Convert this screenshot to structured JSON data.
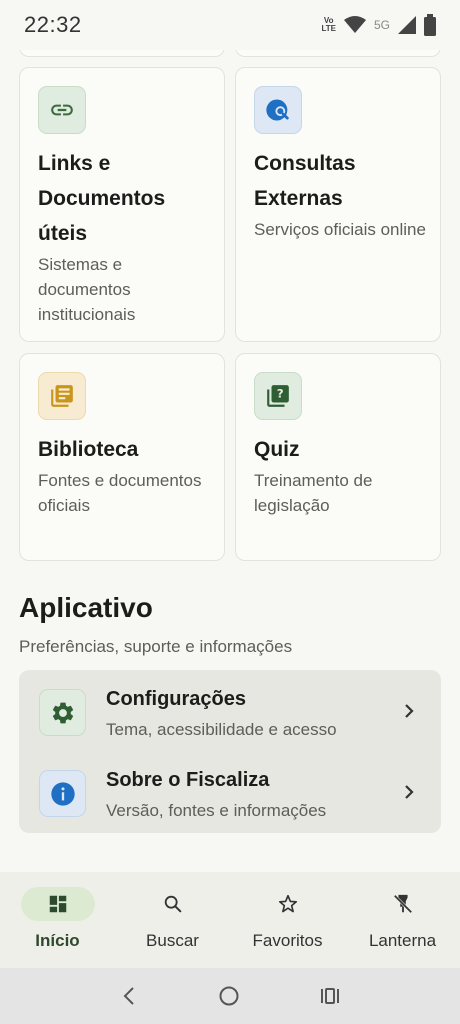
{
  "status_bar": {
    "time": "22:32",
    "volte_top": "Vo",
    "volte_bottom": "LTE",
    "network": "5G"
  },
  "cards": [
    {
      "title": "Links e Documentos úteis",
      "subtitle": "Sistemas e documentos institucionais",
      "icon": "link-icon"
    },
    {
      "title": "Consultas Externas",
      "subtitle": "Serviços oficiais online",
      "icon": "globe-search-icon"
    },
    {
      "title": "Biblioteca",
      "subtitle": "Fontes e documentos oficiais",
      "icon": "library-icon"
    },
    {
      "title": "Quiz",
      "subtitle": "Treinamento de legislação",
      "icon": "quiz-icon"
    }
  ],
  "app_section": {
    "title": "Aplicativo",
    "subtitle": "Preferências, suporte e informações",
    "items": [
      {
        "title": "Configurações",
        "subtitle": "Tema, acessibilidade e acesso",
        "icon": "gear-icon"
      },
      {
        "title": "Sobre o Fiscaliza",
        "subtitle": "Versão, fontes e informações",
        "icon": "info-icon"
      }
    ]
  },
  "bottom_nav": [
    {
      "label": "Início",
      "icon": "dashboard-icon",
      "active": true
    },
    {
      "label": "Buscar",
      "icon": "search-icon",
      "active": false
    },
    {
      "label": "Favoritos",
      "icon": "star-icon",
      "active": false
    },
    {
      "label": "Lanterna",
      "icon": "flashlight-off-icon",
      "active": false
    }
  ],
  "colors": {
    "accent_green": "#3a6b3f",
    "accent_blue": "#1f6fc4",
    "accent_yellow": "#d9a52a",
    "active_pill": "#dcead2"
  }
}
